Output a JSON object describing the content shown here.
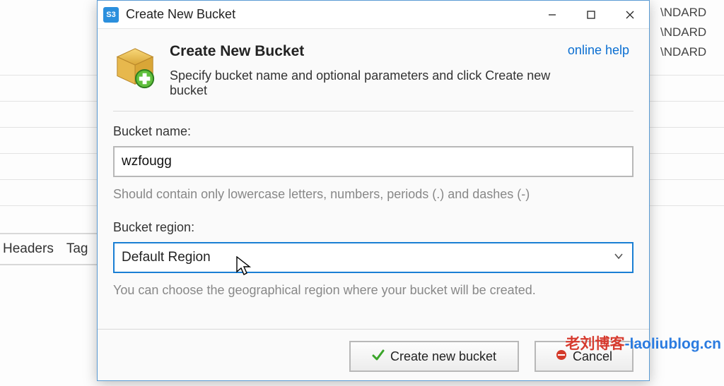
{
  "background": {
    "rows": [
      "\\NDARD",
      "\\NDARD",
      "\\NDARD"
    ],
    "tabs": [
      "Headers",
      "Tag"
    ]
  },
  "dialog": {
    "window_title": "Create New Bucket",
    "app_badge": "S3",
    "online_help": "online help",
    "heading": "Create New Bucket",
    "subheading": "Specify bucket name and optional parameters and click Create new bucket",
    "bucket_name_label": "Bucket name:",
    "bucket_name_value": "wzfougg",
    "bucket_name_hint": "Should contain only lowercase letters, numbers, periods (.) and dashes (-)",
    "region_label": "Bucket region:",
    "region_value": "Default Region",
    "region_hint": "You can choose the geographical region where your bucket will be created.",
    "create_button": "Create new bucket",
    "cancel_button": "Cancel"
  },
  "watermark": "老刘博客-laoliublog.cn"
}
